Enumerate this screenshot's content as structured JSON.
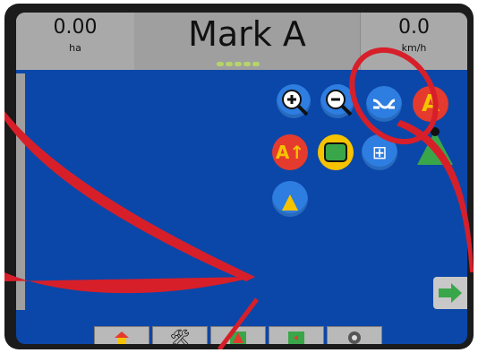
{
  "header": {
    "left_value": "0.00",
    "left_unit": "ha",
    "title": "Mark A",
    "right_value": "0.0",
    "right_unit": "km/h"
  },
  "indicators": {
    "guidance_leds": 5
  },
  "icons": {
    "zoom_in": "zoom-in-icon",
    "zoom_out": "zoom-out-icon",
    "curve_pattern": "curve-pattern-icon",
    "mark_a": "mark-a-icon",
    "mark_a_plus": "mark-a-plus-icon",
    "boundary": "boundary-icon",
    "marker_plus": "marker-plus-icon",
    "green_triangle": "triangle-icon",
    "cone": "cone-icon",
    "right_arrow": "arrow-right-icon"
  },
  "bottom_buttons": [
    {
      "name": "home-button",
      "icon": "home-icon"
    },
    {
      "name": "tools-button",
      "icon": "tools-icon"
    },
    {
      "name": "field-view-button",
      "icon": "field-view-icon"
    },
    {
      "name": "map-button",
      "icon": "map-icon"
    },
    {
      "name": "camera-button",
      "icon": "camera-icon"
    }
  ],
  "colors": {
    "screen_bg": "#0b47a8",
    "accent_red": "#e53a2e",
    "accent_yellow": "#f6c300",
    "accent_green": "#3aa64a"
  }
}
